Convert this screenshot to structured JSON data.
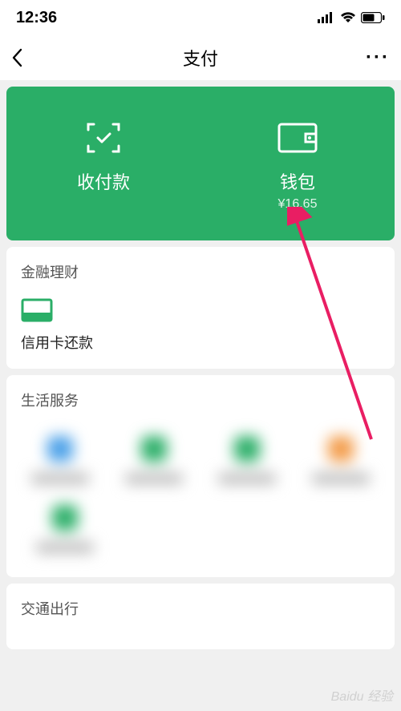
{
  "status": {
    "time": "12:36"
  },
  "nav": {
    "title": "支付",
    "more": "···"
  },
  "greenCard": {
    "pay": {
      "label": "收付款"
    },
    "wallet": {
      "label": "钱包",
      "balance": "¥16.65"
    }
  },
  "sections": {
    "finance": {
      "title": "金融理财",
      "card": {
        "label": "信用卡还款"
      }
    },
    "life": {
      "title": "生活服务"
    },
    "transport": {
      "title": "交通出行"
    }
  },
  "watermark": "Baidu 经验"
}
